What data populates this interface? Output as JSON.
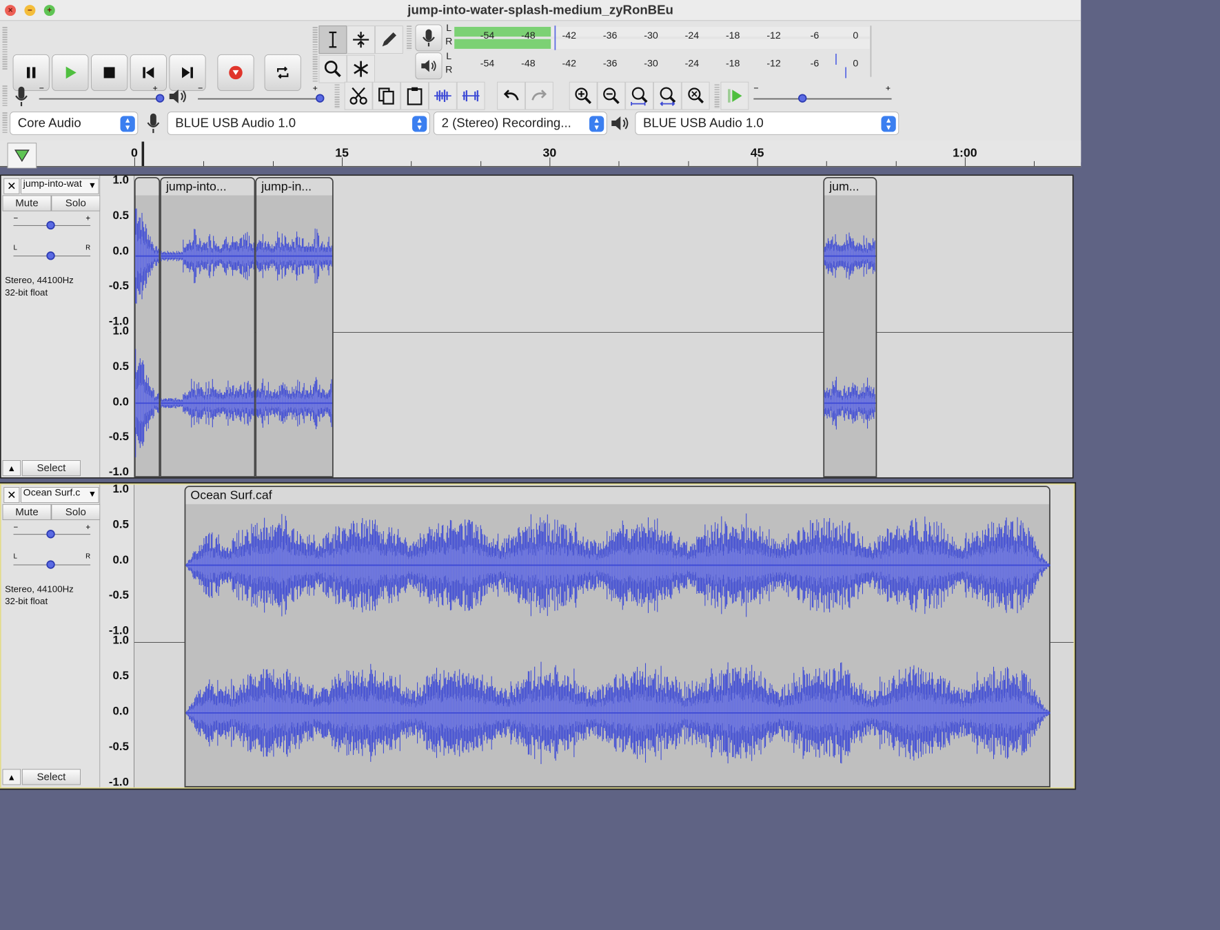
{
  "window": {
    "title": "jump-into-water-splash-medium_zyRonBEu"
  },
  "colors": {
    "waveform": "#3c49d6",
    "waveform_rms": "#6c75e0",
    "meter_fill": "#7cd174",
    "accent": "#3b7ff0",
    "background": "#5f6384"
  },
  "transport": {
    "buttons": [
      "pause-icon",
      "play-icon",
      "stop-icon",
      "skip-to-start-icon",
      "skip-to-end-icon",
      "record-icon",
      "loop-icon"
    ]
  },
  "meters": {
    "ticks": [
      "-54",
      "-48",
      "-42",
      "-36",
      "-30",
      "-24",
      "-18",
      "-12",
      "-6",
      "0"
    ],
    "recording": {
      "channels": [
        "L",
        "R"
      ],
      "level_db_L": -48,
      "level_db_R": -48
    },
    "playback": {
      "channels": [
        "L",
        "R"
      ]
    }
  },
  "mixer": {
    "minus": "−",
    "plus": "+"
  },
  "device": {
    "host": "Core Audio",
    "input": "BLUE USB Audio 1.0",
    "channels": "2 (Stereo) Recording...",
    "output": "BLUE USB Audio 1.0"
  },
  "ruler": {
    "labels": [
      "0",
      "15",
      "30",
      "45",
      "1:00"
    ]
  },
  "tracks": [
    {
      "name": "jump-into-wat",
      "mute": "Mute",
      "solo": "Solo",
      "pan_l": "L",
      "pan_r": "R",
      "gain_minus": "−",
      "gain_plus": "+",
      "rate": "Stereo, 44100Hz",
      "format": "32-bit float",
      "select": "Select",
      "clips": [
        {
          "label": ""
        },
        {
          "label": "jump-into..."
        },
        {
          "label": "jump-in..."
        },
        {
          "label": "jum..."
        }
      ],
      "scale": [
        "1.0",
        "0.5",
        "0.0",
        "-0.5",
        "-1.0"
      ]
    },
    {
      "name": "Ocean Surf.c",
      "mute": "Mute",
      "solo": "Solo",
      "pan_l": "L",
      "pan_r": "R",
      "gain_minus": "−",
      "gain_plus": "+",
      "rate": "Stereo, 44100Hz",
      "format": "32-bit float",
      "select": "Select",
      "clips": [
        {
          "label": "Ocean Surf.caf"
        }
      ],
      "scale": [
        "1.0",
        "0.5",
        "0.0",
        "-0.5",
        "-1.0"
      ]
    }
  ]
}
